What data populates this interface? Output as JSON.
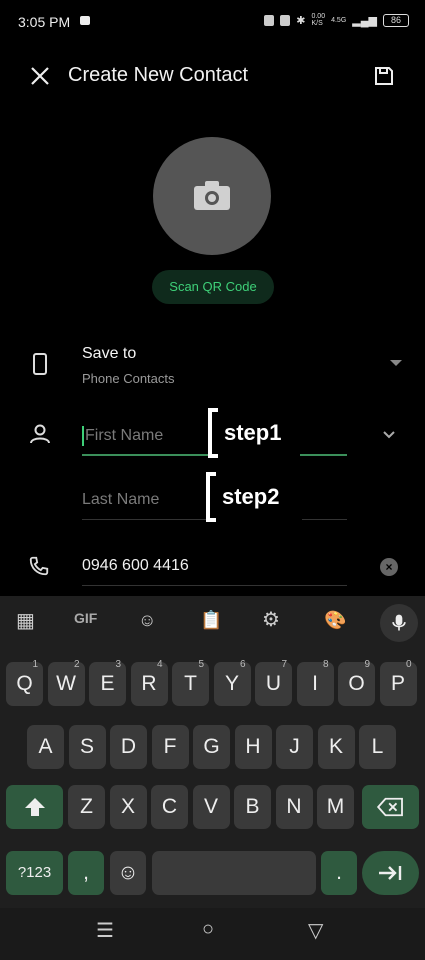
{
  "status_bar": {
    "time": "3:05 PM",
    "battery": "86",
    "network": "0.00\nK/S",
    "signal": "4.5G"
  },
  "app_bar": {
    "title": "Create New Contact"
  },
  "photo": {
    "scan_qr_label": "Scan QR Code"
  },
  "save_to": {
    "label": "Save to",
    "value": "Phone Contacts"
  },
  "name": {
    "first_placeholder": "First Name",
    "last_placeholder": "Last Name"
  },
  "phone": {
    "value": "0946 600 4416"
  },
  "annotations": {
    "step1": "step1",
    "step2": "step2"
  },
  "keyboard": {
    "toolbar": {
      "gif_label": "GIF"
    },
    "row1": [
      {
        "k": "Q",
        "n": "1"
      },
      {
        "k": "W",
        "n": "2"
      },
      {
        "k": "E",
        "n": "3"
      },
      {
        "k": "R",
        "n": "4"
      },
      {
        "k": "T",
        "n": "5"
      },
      {
        "k": "Y",
        "n": "6"
      },
      {
        "k": "U",
        "n": "7"
      },
      {
        "k": "I",
        "n": "8"
      },
      {
        "k": "O",
        "n": "9"
      },
      {
        "k": "P",
        "n": "0"
      }
    ],
    "row2": [
      "A",
      "S",
      "D",
      "F",
      "G",
      "H",
      "J",
      "K",
      "L"
    ],
    "row3": [
      "Z",
      "X",
      "C",
      "V",
      "B",
      "N",
      "M"
    ],
    "symbols_label": "?123",
    "comma_label": ",",
    "period_label": "."
  },
  "colors": {
    "accent": "#3ecf78",
    "key": "#3a3a3a",
    "action_key": "#2f5a3f"
  }
}
